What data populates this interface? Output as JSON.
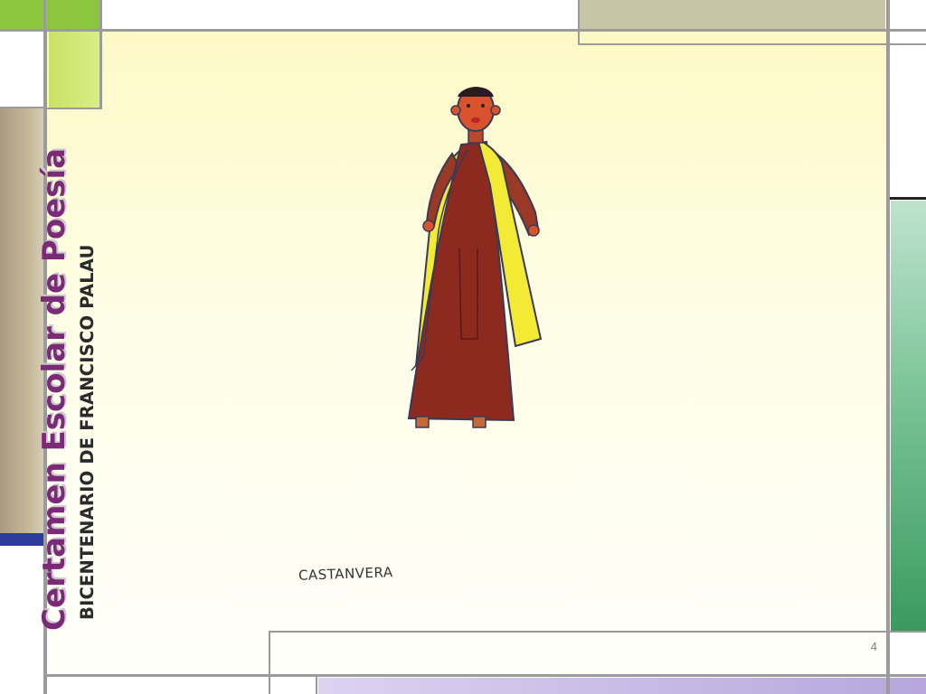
{
  "slide": {
    "title": "Certamen Escolar de Poesía",
    "subtitle": "BICENTENARIO DE FRANCISCO PALAU",
    "artwork_signature": "CASTANVERA",
    "slide_number": "4"
  },
  "colors": {
    "title": "#7b2a78",
    "lime_block": "#8cc63f",
    "lime_light": "#cfe56c",
    "taupe_block": "#c8c4a6",
    "tan_bar": "#c3b593",
    "blue_bar": "#2f3b9a",
    "green_bar": "#3a9a5e",
    "lavender_bar": "#cabde6",
    "robe": "#8c2a1f",
    "cape": "#f2ea34"
  },
  "icons": [
    "child-drawing-figure"
  ]
}
